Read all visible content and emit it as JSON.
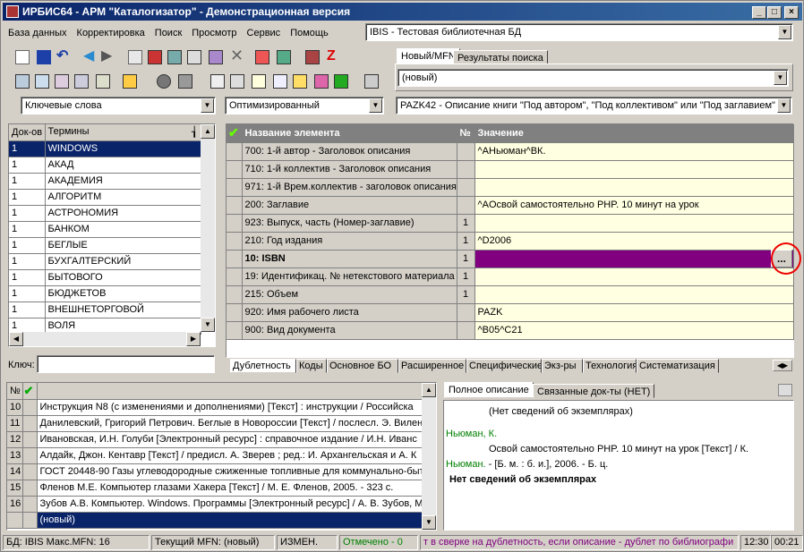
{
  "window": {
    "title": "ИРБИС64 - АРМ \"Каталогизатор\" - Демонстрационная версия"
  },
  "menu": [
    "База данных",
    "Корректировка",
    "Поиск",
    "Просмотр",
    "Сервис",
    "Помощь"
  ],
  "db_selector": {
    "value": "IBIS - Тестовая библиотечная БД"
  },
  "top_tabs": [
    "Новый/MFN",
    "Результаты поиска"
  ],
  "record_selector": {
    "value": "(новый)"
  },
  "dictionary_selector": {
    "value": "Ключевые слова"
  },
  "mode_selector": {
    "value": "Оптимизированный"
  },
  "worksheet_selector": {
    "value": "PAZK42 - Описание книги \"Под автором\", \"Под коллективом\" или \"Под заглавием\""
  },
  "terms": {
    "headers": {
      "count": "Док-ов",
      "term": "Термины"
    },
    "rows": [
      {
        "count": "1",
        "term": "WINDOWS"
      },
      {
        "count": "1",
        "term": "АКАД"
      },
      {
        "count": "1",
        "term": "АКАДЕМИЯ"
      },
      {
        "count": "1",
        "term": "АЛГОРИТМ"
      },
      {
        "count": "1",
        "term": "АСТРОНОМИЯ"
      },
      {
        "count": "1",
        "term": "БАНКОМ"
      },
      {
        "count": "1",
        "term": "БЕГЛЫЕ"
      },
      {
        "count": "1",
        "term": "БУХГАЛТЕРСКИЙ"
      },
      {
        "count": "1",
        "term": "БЫТОВОГО"
      },
      {
        "count": "1",
        "term": "БЮДЖЕТОВ"
      },
      {
        "count": "1",
        "term": "ВНЕШНЕТОРГОВОЙ"
      },
      {
        "count": "1",
        "term": "ВОЛЯ"
      }
    ],
    "key_label": "Ключ:"
  },
  "fields": {
    "headers": {
      "name": "Название элемента",
      "num": "№",
      "value": "Значение"
    },
    "rows": [
      {
        "name": "700: 1-й автор - Заголовок описания",
        "num": "",
        "value": "^AНьюман^BК."
      },
      {
        "name": "710: 1-й коллектив - Заголовок описания",
        "num": "",
        "value": ""
      },
      {
        "name": "971: 1-й Врем.коллектив - заголовок описания",
        "num": "",
        "value": ""
      },
      {
        "name": "200: Заглавие",
        "num": "",
        "value": "^AОсвой самостоятельно PHP. 10 минут на урок"
      },
      {
        "name": "923: Выпуск, часть (Номер-заглавие)",
        "num": "1",
        "value": ""
      },
      {
        "name": "210: Год издания",
        "num": "1",
        "value": "^D2006"
      },
      {
        "name": "10: ISBN",
        "num": "1",
        "value": ""
      },
      {
        "name": "19: Идентификац. № нетекстового материала",
        "num": "1",
        "value": ""
      },
      {
        "name": "215: Объем",
        "num": "1",
        "value": ""
      },
      {
        "name": "920: Имя рабочего листа",
        "num": "",
        "value": "PAZK"
      },
      {
        "name": "900: Вид документа",
        "num": "",
        "value": "^B05^C21"
      }
    ],
    "ellipsis": "..."
  },
  "bottom_tabs": [
    "Дублетность",
    "Коды",
    "Основное БО",
    "Расширенное",
    "Специфические",
    "Экз-ры",
    "Технология",
    "Систематизация"
  ],
  "records": {
    "headers": {
      "num": "№"
    },
    "rows": [
      {
        "num": "10",
        "text": "Инструкция N8  (с изменениями и дополнениями) [Текст] : инструкции / Российска"
      },
      {
        "num": "11",
        "text": "Данилевский, Григорий Петрович. Беглые в Новороссии [Текст] / послесл. Э. Вилен"
      },
      {
        "num": "12",
        "text": "Ивановская, И.Н. Голуби [Электронный ресурс] : справочное издание / И.Н. Иванс"
      },
      {
        "num": "13",
        "text": "Алдайк, Джон. Кентавр [Текст] / предисл. А. Зверев ; ред.: И. Архангельская и А. К"
      },
      {
        "num": "14",
        "text": "ГОСТ 20448-90 Газы углеводородные сжиженные топливные для коммунально-быт"
      },
      {
        "num": "15",
        "text": "Фленов М.Е. Компьютер глазами Хакера [Текст] / М. Е. Фленов, 2005. - 323 с."
      },
      {
        "num": "16",
        "text": "Зубов А.В. Компьютер. Windows. Программы [Электронный ресурс] / А. В. Зубов, М"
      },
      {
        "num": "",
        "text": "(новый)"
      }
    ]
  },
  "desc_tabs": [
    "Полное описание",
    "Связанные док-ты (НЕТ)"
  ],
  "description": {
    "line1": "(Нет сведений об экземплярах)",
    "author1": "Ньюман, К.",
    "line2": "Освой самостоятельно PHP. 10 минут на урок [Текст] / К.",
    "author2": "Ньюман.",
    "line3": " - [Б. м. : б. и.], 2006. - Б. ц.",
    "line4": "Нет сведений об экземплярах"
  },
  "status": {
    "db": "БД: IBIS Макс.MFN: 16",
    "current": "Текущий MFN: (новый)",
    "changed": "ИЗМЕН.",
    "marked": "Отмечено - 0",
    "hint": "т в сверке на дублетность, если описание - дублет по библиографи",
    "time1": "12:30",
    "time2": "00:21"
  },
  "colors": {
    "selection": "#0a246a",
    "highlight_row": "#800080",
    "value_bg": "#ffffe1",
    "author": "#008000",
    "hint": "#800080"
  }
}
